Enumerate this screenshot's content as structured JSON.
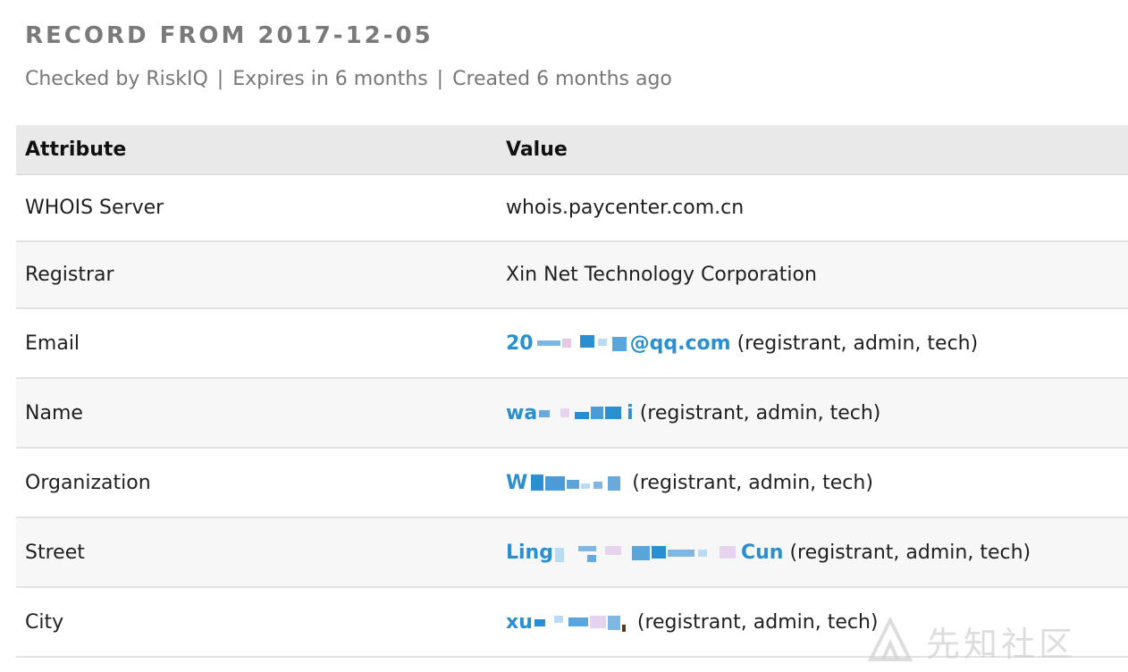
{
  "record": {
    "title": "RECORD FROM 2017-12-05",
    "checked_by": "Checked by RiskIQ",
    "expires": "Expires in 6 months",
    "created": "Created 6 months ago",
    "separator": "|"
  },
  "table": {
    "headers": {
      "attribute": "Attribute",
      "value": "Value"
    },
    "rows": [
      {
        "attribute": "WHOIS Server",
        "value": "whois.paycenter.com.cn"
      },
      {
        "attribute": "Registrar",
        "value": "Xin Net Technology Corporation"
      },
      {
        "attribute": "Email",
        "value_prefix": "20",
        "value_suffix": "@qq.com",
        "roles": "(registrant, admin, tech)"
      },
      {
        "attribute": "Name",
        "value_prefix": "wa",
        "value_suffix": "i",
        "roles": "(registrant, admin, tech)"
      },
      {
        "attribute": "Organization",
        "value_prefix": "W",
        "value_suffix": "",
        "roles": "(registrant, admin, tech)"
      },
      {
        "attribute": "Street",
        "value_prefix": "Ling",
        "value_suffix": "Cun",
        "roles": "(registrant, admin, tech)"
      },
      {
        "attribute": "City",
        "value_prefix": "xu",
        "value_suffix": "",
        "roles": "(registrant, admin, tech)"
      }
    ]
  },
  "watermark": {
    "text": "先知社区"
  },
  "colors": {
    "link": "#2a8fd0",
    "title": "#7a7a7a",
    "meta": "#777777",
    "header_bg": "#e9e9e9",
    "row_alt_bg": "#f7f7f7"
  }
}
